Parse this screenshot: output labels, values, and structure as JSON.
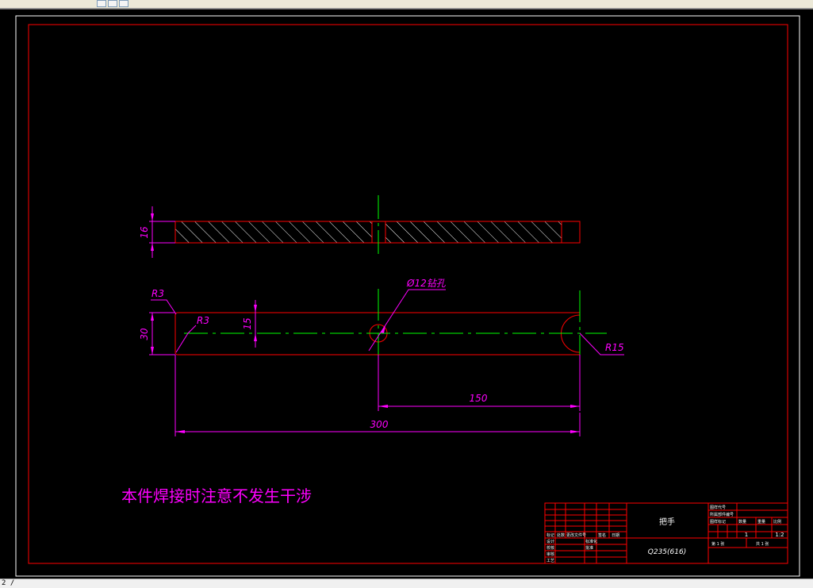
{
  "status_bar": {
    "command_text": "2 /"
  },
  "drawing": {
    "dimensions": {
      "plate_thickness": "16",
      "width": "30",
      "center_offset": "15",
      "total_length": "300",
      "hole_position": "150",
      "corner_radius_top": "R3",
      "corner_radius_bottom": "R3",
      "end_radius": "R15",
      "hole_callout": "Ø12钻孔"
    },
    "note": "本件焊接时注意不发生干涉"
  },
  "title_block": {
    "part_name": "把手",
    "material": "Q235(616)",
    "header_row": [
      "标记",
      "处数",
      "更改文件号",
      "签名",
      "日期"
    ],
    "roles": [
      "设计",
      "校核",
      "审核",
      "工艺"
    ],
    "role_sign": [
      "标准化",
      "批准"
    ],
    "right_top": [
      "图样代号",
      "所属部件编号"
    ],
    "stage_labels": [
      "图样标记",
      "数量",
      "重量",
      "比例"
    ],
    "qty": "1",
    "scale": "1:2",
    "sheet_labels": [
      "第 1 张",
      "共 1 张"
    ]
  },
  "colors": {
    "background": "#000000",
    "frame": "#ff0000",
    "outline": "#ff0000",
    "dimension": "#ff00ff",
    "centerline": "#00ff00",
    "text": "#ff00ff",
    "title_text": "#ffffff"
  }
}
